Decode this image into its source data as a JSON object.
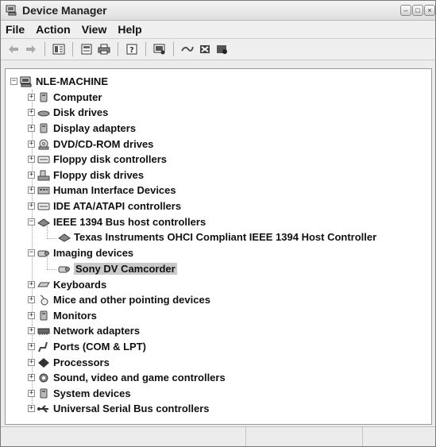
{
  "window": {
    "title": "Device Manager"
  },
  "menu": [
    {
      "label": "File"
    },
    {
      "label": "Action"
    },
    {
      "label": "View"
    },
    {
      "label": "Help"
    }
  ],
  "toolbar_icons": [
    "back-icon",
    "forward-icon",
    "properties-grid-icon",
    "properties-icon",
    "print-icon",
    "help-icon",
    "scan-hardware-icon",
    "update-driver-icon",
    "uninstall-icon",
    "disable-icon"
  ],
  "tree": {
    "root": {
      "label": "NLE-MACHINE",
      "expanded": true
    },
    "nodes": [
      {
        "label": "Computer",
        "icon": "computer-icon",
        "expanded": false
      },
      {
        "label": "Disk drives",
        "icon": "disk-drive-icon",
        "expanded": false
      },
      {
        "label": "Display adapters",
        "icon": "display-adapter-icon",
        "expanded": false
      },
      {
        "label": "DVD/CD-ROM drives",
        "icon": "dvd-drive-icon",
        "expanded": false
      },
      {
        "label": "Floppy disk controllers",
        "icon": "floppy-controller-icon",
        "expanded": false
      },
      {
        "label": "Floppy disk drives",
        "icon": "floppy-drive-icon",
        "expanded": false
      },
      {
        "label": "Human Interface Devices",
        "icon": "hid-icon",
        "expanded": false
      },
      {
        "label": "IDE ATA/ATAPI controllers",
        "icon": "ide-controller-icon",
        "expanded": false
      },
      {
        "label": "IEEE 1394 Bus host controllers",
        "icon": "ieee1394-icon",
        "expanded": true,
        "children": [
          {
            "label": "Texas Instruments OHCI Compliant IEEE 1394 Host Controller",
            "icon": "ieee1394-icon"
          }
        ]
      },
      {
        "label": "Imaging devices",
        "icon": "imaging-device-icon",
        "expanded": true,
        "children": [
          {
            "label": "Sony DV Camcorder",
            "icon": "camcorder-icon",
            "selected": true
          }
        ]
      },
      {
        "label": "Keyboards",
        "icon": "keyboard-icon",
        "expanded": false
      },
      {
        "label": "Mice and other pointing devices",
        "icon": "mouse-icon",
        "expanded": false
      },
      {
        "label": "Monitors",
        "icon": "monitor-icon",
        "expanded": false
      },
      {
        "label": "Network adapters",
        "icon": "network-adapter-icon",
        "expanded": false
      },
      {
        "label": "Ports (COM & LPT)",
        "icon": "ports-icon",
        "expanded": false
      },
      {
        "label": "Processors",
        "icon": "processor-icon",
        "expanded": false
      },
      {
        "label": "Sound, video and game controllers",
        "icon": "sound-icon",
        "expanded": false
      },
      {
        "label": "System devices",
        "icon": "system-device-icon",
        "expanded": false
      },
      {
        "label": "Universal Serial Bus controllers",
        "icon": "usb-icon",
        "expanded": false
      }
    ]
  },
  "colors": {
    "selection": "#c9c9c9"
  }
}
